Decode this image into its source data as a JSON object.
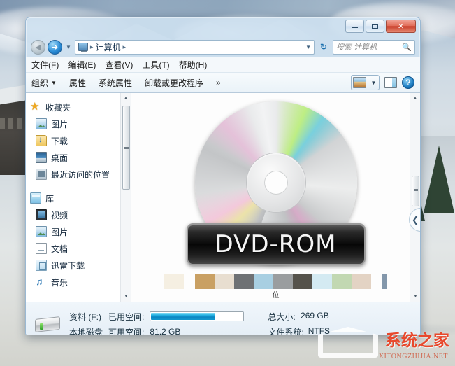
{
  "window": {
    "title_controls": {
      "minimize": "—",
      "maximize": "□",
      "close": "✕"
    }
  },
  "navbar": {
    "back_icon": "◀",
    "forward_icon": "➜",
    "history_caret": "▼",
    "breadcrumb_icon": "computer-icon",
    "breadcrumb_root": "计算机",
    "sep1": "▸",
    "sep2": "▸",
    "address_caret": "▼",
    "refresh_icon": "↻",
    "search_placeholder": "搜索 计算机",
    "search_value": "",
    "search_icon": "🔍"
  },
  "menubar": {
    "items": [
      {
        "label": "文件(F)"
      },
      {
        "label": "编辑(E)"
      },
      {
        "label": "查看(V)"
      },
      {
        "label": "工具(T)"
      },
      {
        "label": "帮助(H)"
      }
    ]
  },
  "toolbar": {
    "organize": "组织",
    "organize_caret": "▼",
    "properties": "属性",
    "system_properties": "系统属性",
    "uninstall": "卸载或更改程序",
    "overflow": "»",
    "view_caret": "▼",
    "help_label": "?"
  },
  "sidebar": {
    "groups": [
      {
        "root": {
          "label": "收藏夹",
          "icon": "star-icon"
        },
        "items": [
          {
            "label": "图片",
            "icon": "picture-icon"
          },
          {
            "label": "下载",
            "icon": "download-icon"
          },
          {
            "label": "桌面",
            "icon": "desktop-icon"
          },
          {
            "label": "最近访问的位置",
            "icon": "recent-places-icon"
          }
        ]
      },
      {
        "root": {
          "label": "库",
          "icon": "library-icon"
        },
        "items": [
          {
            "label": "视频",
            "icon": "video-icon"
          },
          {
            "label": "图片",
            "icon": "picture-icon"
          },
          {
            "label": "文档",
            "icon": "document-icon"
          },
          {
            "label": "迅雷下载",
            "icon": "thunder-download-icon"
          },
          {
            "label": "音乐",
            "icon": "music-icon"
          }
        ]
      }
    ],
    "scroll_up": "▲",
    "scroll_down": "▼"
  },
  "content": {
    "disc_label": "DVD-ROM",
    "small_label": "位",
    "scroll_up": "▲",
    "scroll_down": "▼",
    "collapse_icon": "❮",
    "swatches": [
      "#f5efe2",
      "",
      "#c9a063",
      "#e8ded0",
      "#6e7174",
      "#a8cfe2",
      "#9a9d9f",
      "#55524b",
      "#d4eaf2",
      "#c2d8b2",
      "#e3d3c4",
      "",
      "#8397ab"
    ]
  },
  "statusbar": {
    "drive_name": "资料 (F:)",
    "drive_type": "本地磁盘",
    "used_label": "已用空间:",
    "free_label": "可用空间:",
    "free_value": "81.2 GB",
    "total_label": "总大小:",
    "total_value": "269 GB",
    "fs_label": "文件系统:",
    "fs_value": "NTFS",
    "used_percent": 70
  },
  "watermark": {
    "cn": "系统之家",
    "en": "XITONGZHIJIA.NET"
  }
}
